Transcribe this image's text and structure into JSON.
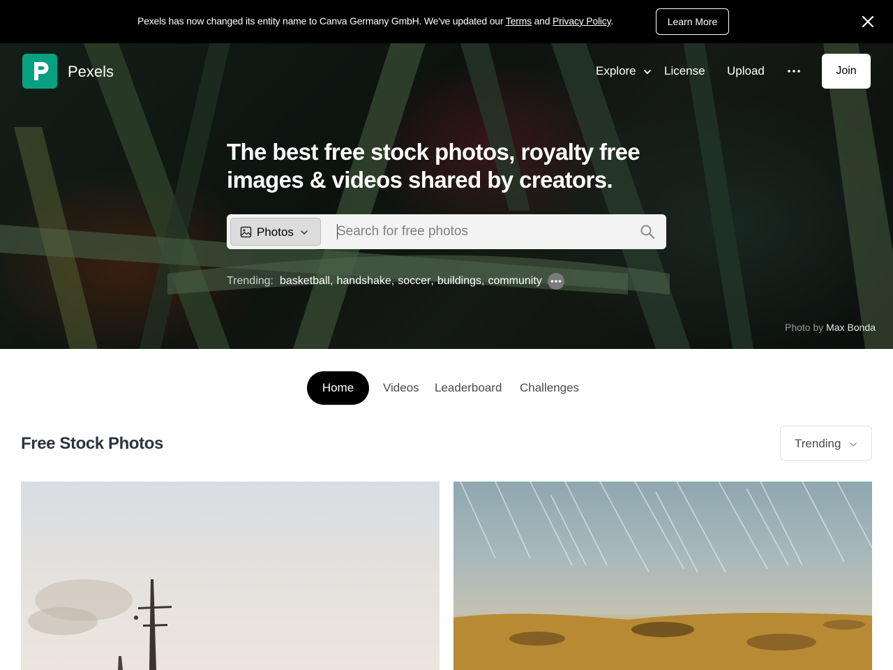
{
  "announcement": {
    "text_before": "Pexels has now changed its entity name to Canva Germany GmbH. We've updated our ",
    "terms_link": "Terms",
    "and": " and ",
    "privacy_link": "Privacy Policy",
    "text_after": ".",
    "learn_more": "Learn More",
    "close_icon": "close-icon"
  },
  "header": {
    "brand": "Pexels",
    "nav": {
      "explore": "Explore",
      "license": "License",
      "upload": "Upload",
      "more_icon": "more-horizontal-icon"
    },
    "join": "Join"
  },
  "hero": {
    "headline_line1": "The best free stock photos, royalty free",
    "headline_line2": "images & videos shared by creators.",
    "search": {
      "type_label": "Photos",
      "placeholder": "Search for free photos",
      "value": ""
    },
    "trending": {
      "label": "Trending:",
      "terms": [
        "basketball",
        "handshake",
        "soccer",
        "buildings",
        "community"
      ]
    },
    "credit": {
      "prefix": "Photo by ",
      "name": "Max Bonda"
    }
  },
  "tabs": [
    {
      "label": "Home",
      "active": true
    },
    {
      "label": "Videos",
      "active": false
    },
    {
      "label": "Leaderboard",
      "active": false
    },
    {
      "label": "Challenges",
      "active": false
    }
  ],
  "content": {
    "title": "Free Stock Photos",
    "sort": "Trending"
  },
  "colors": {
    "brand": "#07a081",
    "announcement_bg": "#000000",
    "active_tab": "#000000"
  }
}
